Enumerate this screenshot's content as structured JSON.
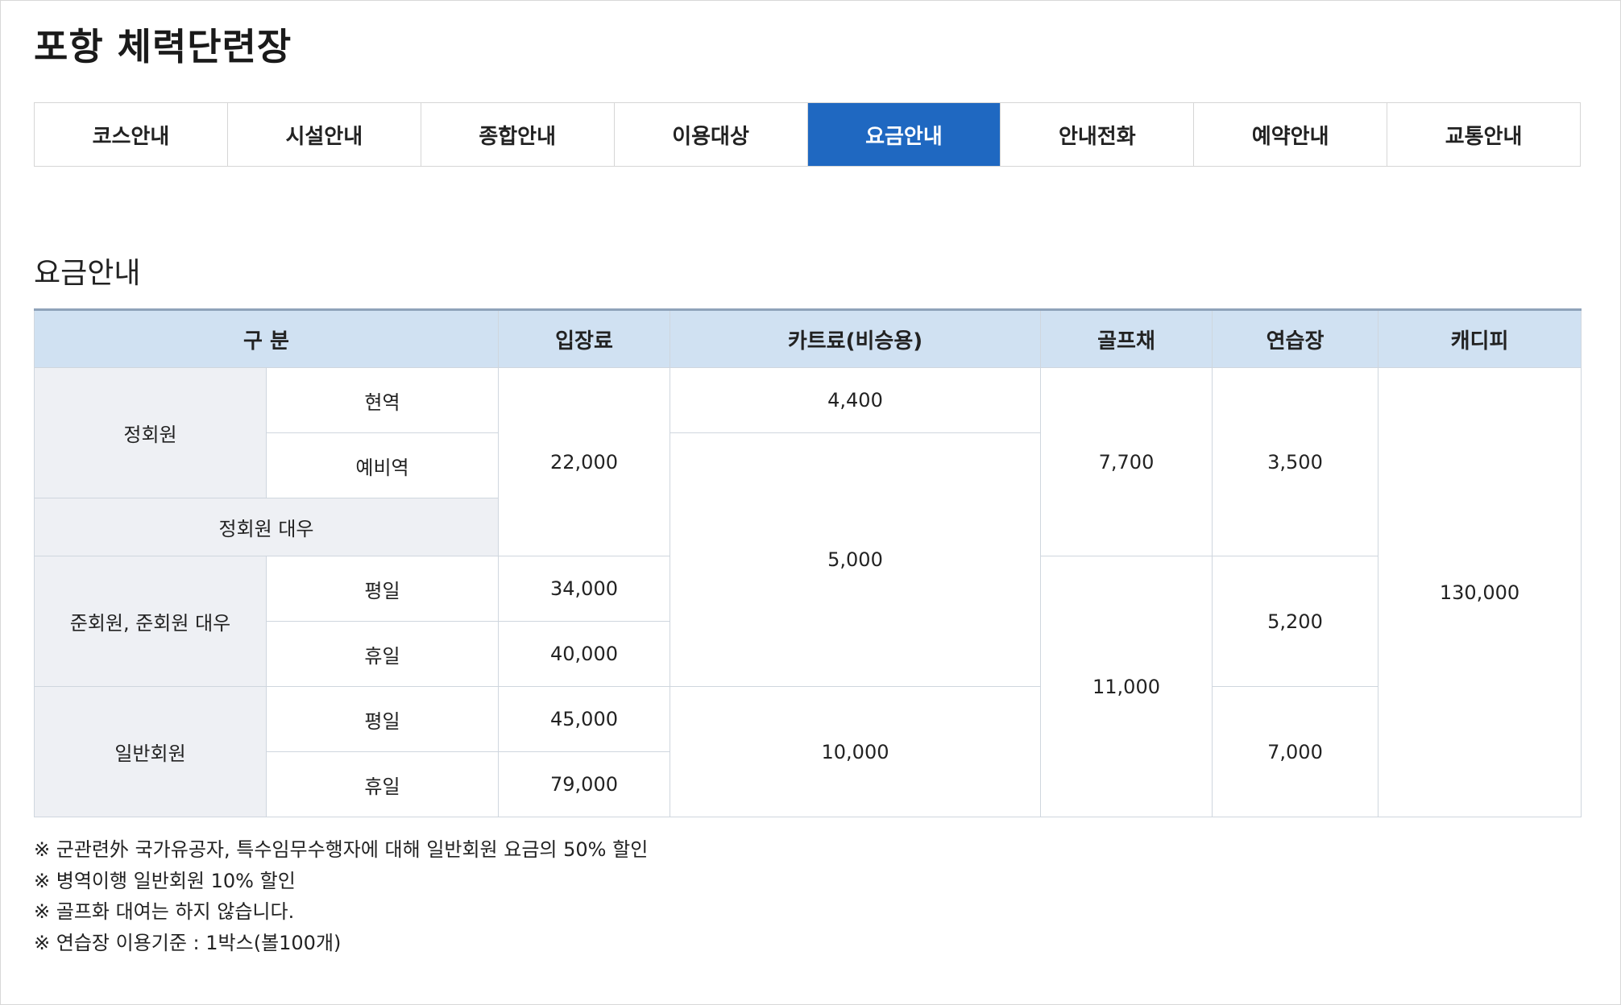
{
  "page": {
    "title": "포항 체력단련장"
  },
  "tabs": [
    {
      "label": "코스안내",
      "active": false
    },
    {
      "label": "시설안내",
      "active": false
    },
    {
      "label": "종합안내",
      "active": false
    },
    {
      "label": "이용대상",
      "active": false
    },
    {
      "label": "요금안내",
      "active": true
    },
    {
      "label": "안내전화",
      "active": false
    },
    {
      "label": "예약안내",
      "active": false
    },
    {
      "label": "교통안내",
      "active": false
    }
  ],
  "section": {
    "title": "요금안내"
  },
  "table": {
    "headers": {
      "category": "구 분",
      "entry": "입장료",
      "cart": "카트료(비승용)",
      "clubs": "골프채",
      "practice": "연습장",
      "caddie": "캐디피"
    },
    "regular": {
      "label": "정회원",
      "active": "현역",
      "reserve": "예비역",
      "equivalent": "정회원 대우",
      "entry": "22,000",
      "cart_active": "4,400",
      "clubs": "7,700",
      "practice": "3,500"
    },
    "associate": {
      "label": "준회원, 준회원 대우",
      "weekday": "평일",
      "holiday": "휴일",
      "entry_weekday": "34,000",
      "entry_holiday": "40,000",
      "practice": "5,200"
    },
    "general": {
      "label": "일반회원",
      "weekday": "평일",
      "holiday": "휴일",
      "entry_weekday": "45,000",
      "entry_holiday": "79,000",
      "cart": "10,000",
      "practice": "7,000"
    },
    "shared": {
      "cart_middle": "5,000",
      "clubs_lower": "11,000",
      "caddie": "130,000"
    }
  },
  "notes": [
    "※ 군관련外 국가유공자, 특수임무수행자에 대해 일반회원 요금의 50% 할인",
    "※ 병역이행 일반회원 10% 할인",
    "※ 골프화 대여는 하지 않습니다.",
    "※ 연습장 이용기준 : 1박스(볼100개)"
  ],
  "colors": {
    "active_tab": "#1f68c1",
    "header_bg": "#d0e1f2",
    "category_bg": "#eef0f4"
  }
}
